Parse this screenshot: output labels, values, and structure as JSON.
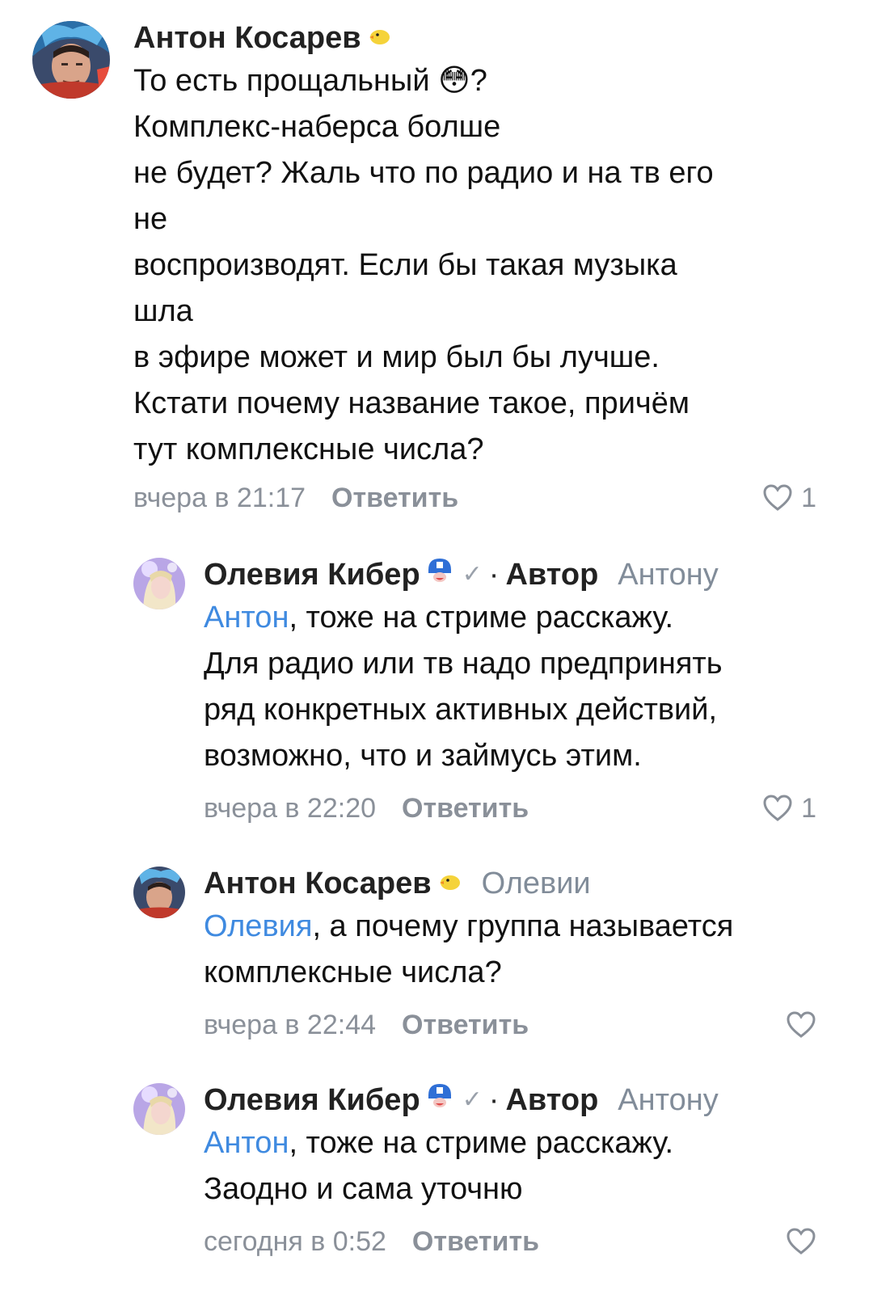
{
  "comments": [
    {
      "author": "Антон Косарев",
      "badge_icon": "chick-icon",
      "verified": false,
      "role": "",
      "reply_to": "",
      "mention": "",
      "text_lines": [
        "То есть прощальный 😳?",
        "Комплекс-наберса болше",
        "не будет? Жаль что по радио и на тв его",
        "не",
        "воспроизводят. Если бы такая музыка",
        "шла",
        "в эфире может и мир был бы лучше.",
        "Кстати почему название такое, причём",
        "тут комплексные числа?"
      ],
      "time": "вчера в 21:17",
      "reply_label": "Ответить",
      "likes": "1"
    },
    {
      "author": "Олевия Кибер",
      "badge_icon": "captain-helmet-icon",
      "verified": true,
      "verified_mark": "✓",
      "separator": "·",
      "role": "Автор",
      "reply_to": "Антону",
      "mention": "Антон",
      "text_first_rest": ", тоже на стриме расскажу.",
      "text_lines": [
        "Для радио или тв надо предпринять",
        "ряд конкретных активных действий,",
        "возможно, что и займусь этим."
      ],
      "time": "вчера в 22:20",
      "reply_label": "Ответить",
      "likes": "1"
    },
    {
      "author": "Антон Косарев",
      "badge_icon": "chick-icon",
      "verified": false,
      "role": "",
      "reply_to": "Олевии",
      "mention": "Олевия",
      "text_first_rest": ", а почему группа называется",
      "text_lines": [
        "комплексные числа?"
      ],
      "time": "вчера в 22:44",
      "reply_label": "Ответить",
      "likes": ""
    },
    {
      "author": "Олевия Кибер",
      "badge_icon": "captain-helmet-icon",
      "verified": true,
      "verified_mark": "✓",
      "separator": "·",
      "role": "Автор",
      "reply_to": "Антону",
      "mention": "Антон",
      "text_first_rest": ", тоже на стриме расскажу.",
      "text_lines": [
        "Заодно и сама уточню"
      ],
      "time": "сегодня в 0:52",
      "reply_label": "Ответить",
      "likes": ""
    }
  ],
  "colors": {
    "link": "#3f8ae0",
    "secondary": "#818c99",
    "text": "#111111"
  }
}
